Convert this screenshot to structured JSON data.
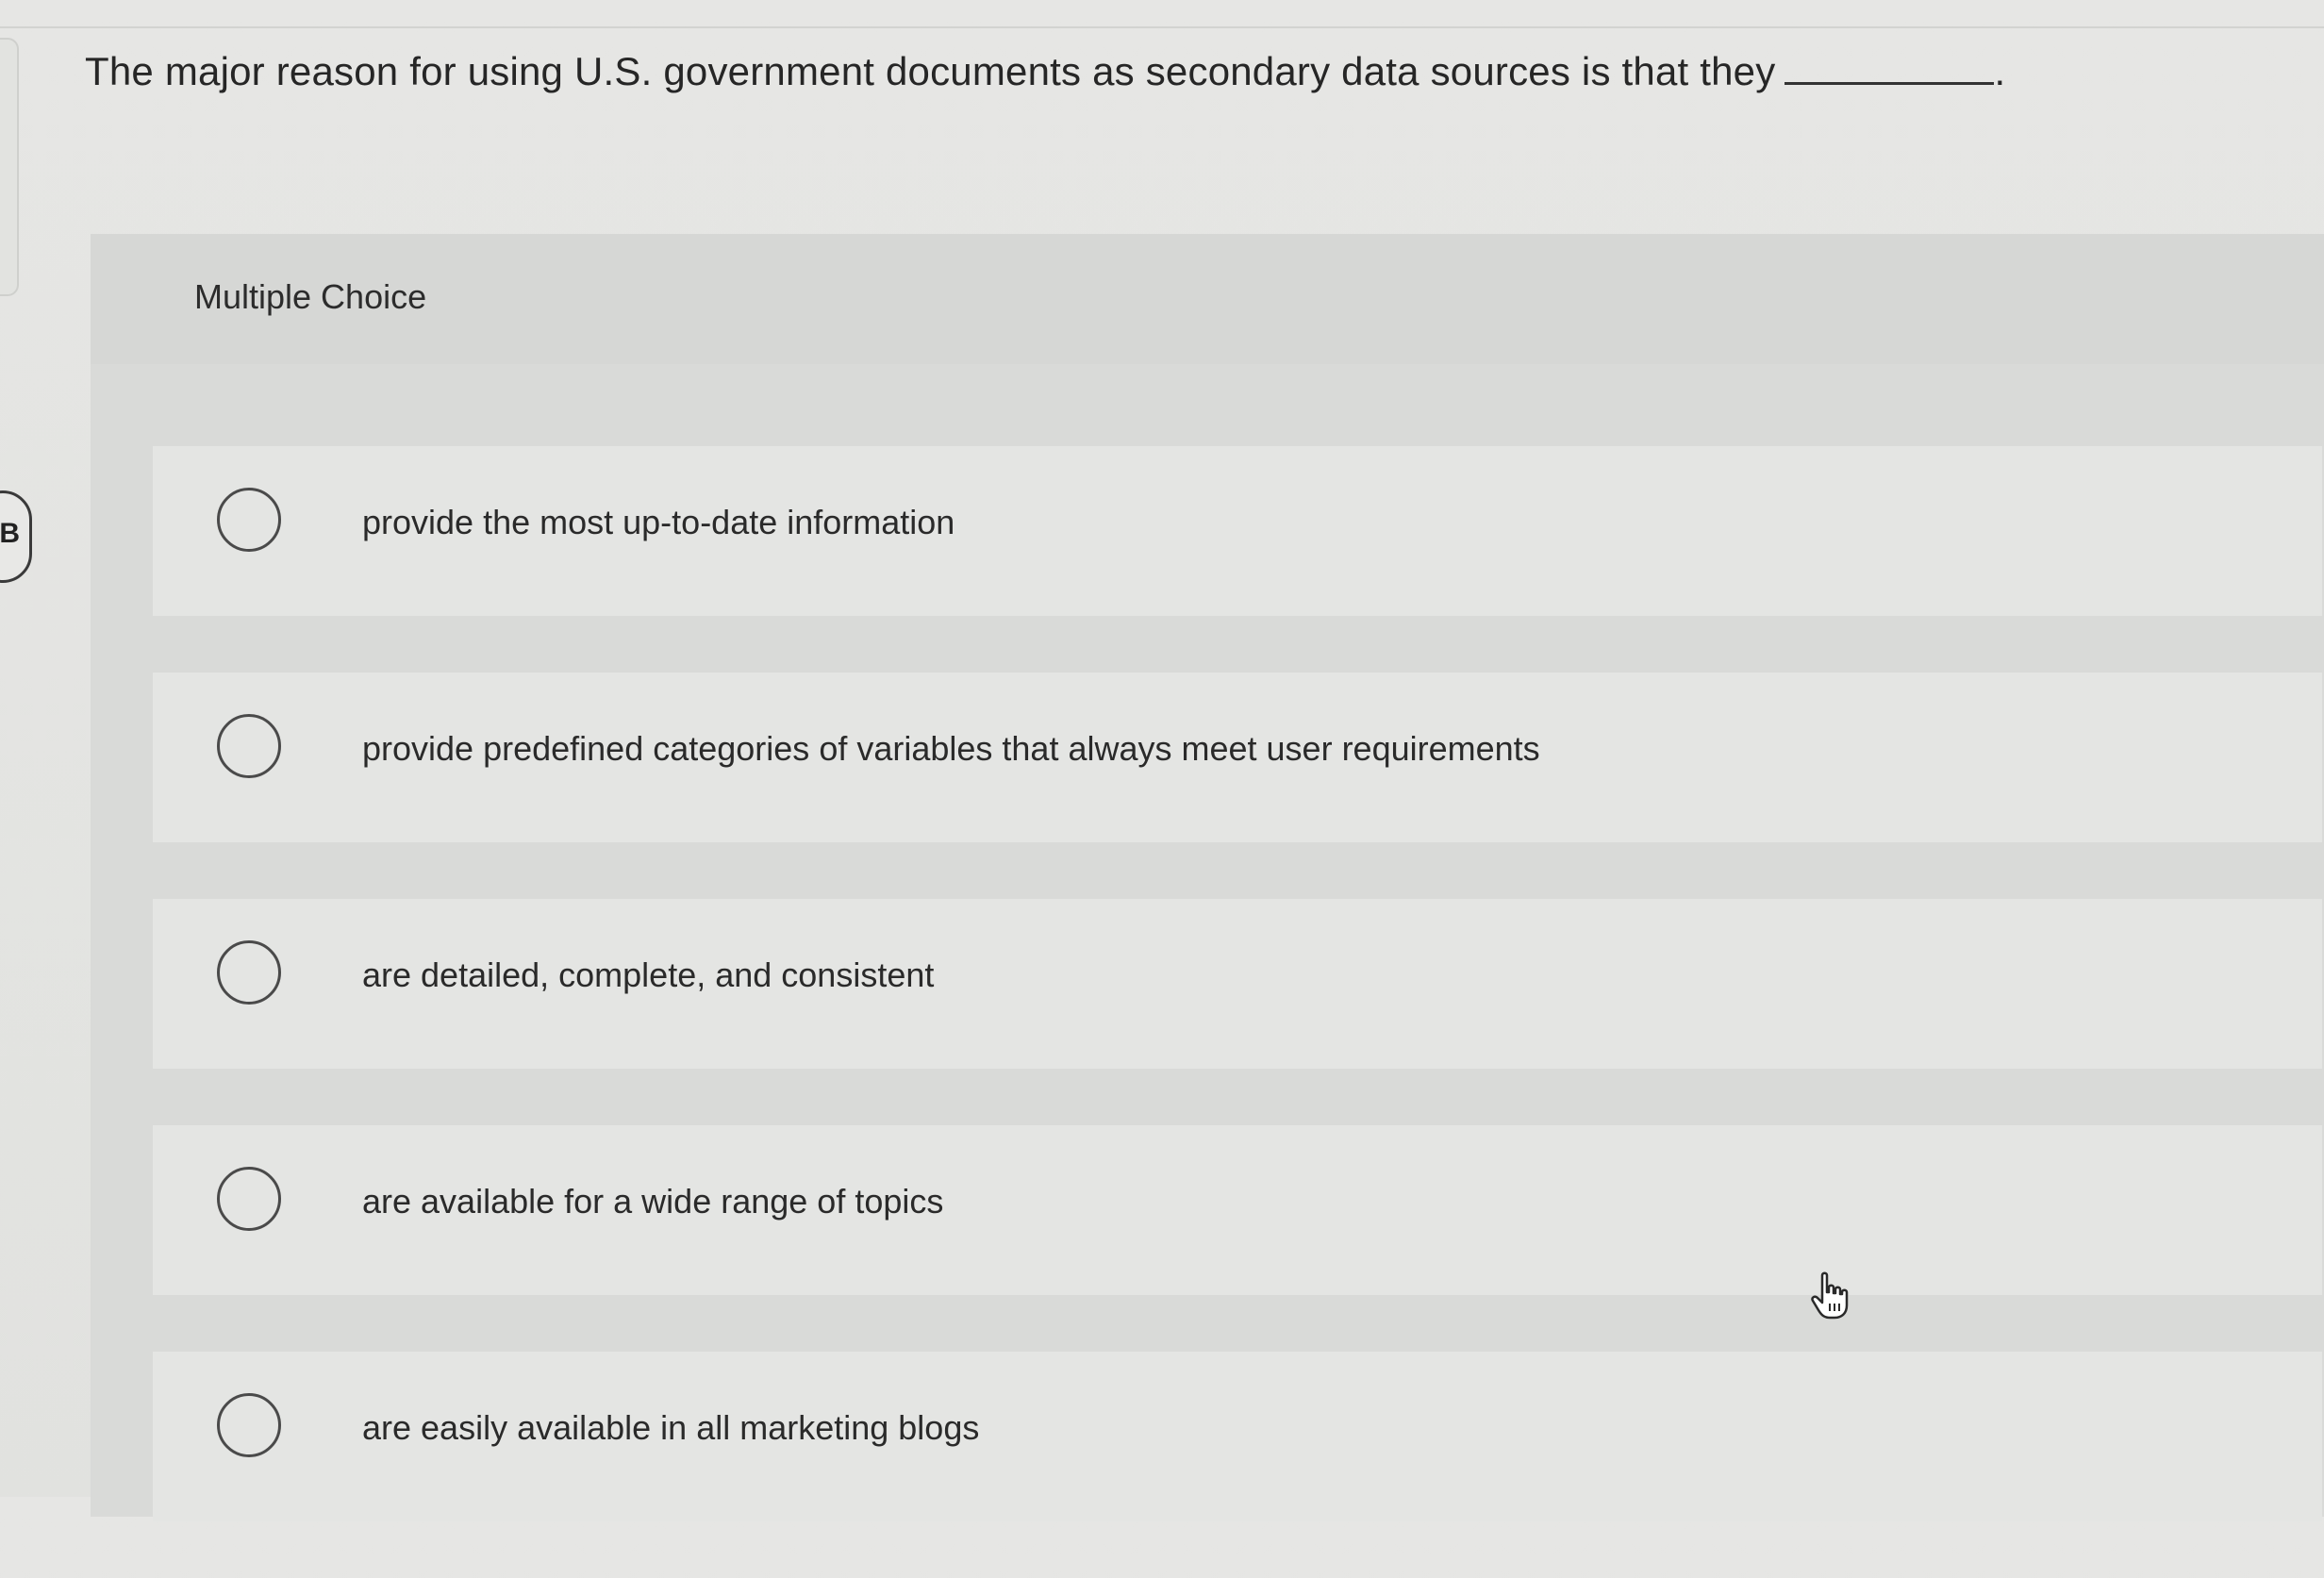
{
  "question": {
    "text": "The major reason for using U.S. government documents as secondary data sources is that they",
    "end_punctuation": "."
  },
  "card": {
    "header": "Multiple Choice"
  },
  "side_badge": "B",
  "options": [
    {
      "label": "provide the most up-to-date information",
      "selected": false
    },
    {
      "label": "provide predefined categories of variables that always meet user requirements",
      "selected": false
    },
    {
      "label": "are detailed, complete, and consistent",
      "selected": false
    },
    {
      "label": "are available for a wide range of topics",
      "selected": false
    },
    {
      "label": "are easily available in all marketing blogs",
      "selected": false
    }
  ],
  "icons": {
    "radio": "radio-unselected-icon",
    "cursor": "hand-pointer-icon"
  }
}
